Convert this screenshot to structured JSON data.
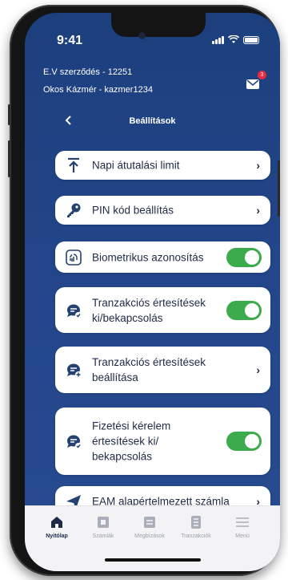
{
  "status_bar": {
    "time": "9:41"
  },
  "header": {
    "contract": "E.V szerződés - 12251",
    "user": "Okos Kázmér - kazmer1234",
    "mail_badge": "3"
  },
  "nav": {
    "back_icon": "chevron-left",
    "title": "Beállítások"
  },
  "settings": [
    {
      "label": "Napi átutalási limit",
      "icon": "limit-up-icon",
      "control": "chevron"
    },
    {
      "label": "PIN kód beállítás",
      "icon": "key-icon",
      "control": "chevron"
    },
    {
      "label": "Biometrikus azonosítás",
      "icon": "fingerprint-icon",
      "control": "toggle",
      "on": true
    },
    {
      "label": "Tranzakciós értesítések ki/bekapcsolás",
      "icon": "chat-check-icon",
      "control": "toggle",
      "on": true
    },
    {
      "label": "Tranzakciós értesítések beállítása",
      "icon": "chat-add-icon",
      "control": "chevron"
    },
    {
      "label": "Fizetési kérelem értesítések ki/ bekapcsolás",
      "icon": "chat-check-icon",
      "control": "toggle",
      "on": true
    },
    {
      "label": "EAM alapértelmezett számla",
      "icon": "send-icon",
      "control": "chevron"
    }
  ],
  "tabbar": [
    {
      "label": "Nyitólap",
      "icon": "home-icon",
      "active": true
    },
    {
      "label": "Számlák",
      "icon": "accounts-icon",
      "active": false
    },
    {
      "label": "Megbízások",
      "icon": "orders-icon",
      "active": false
    },
    {
      "label": "Tranzakciók",
      "icon": "transactions-icon",
      "active": false
    },
    {
      "label": "Menü",
      "icon": "menu-icon",
      "active": false
    }
  ],
  "colors": {
    "background": "#23468a",
    "toggle_on": "#3cab4c",
    "text_dark": "#1e2a46",
    "badge": "#e8293f"
  }
}
